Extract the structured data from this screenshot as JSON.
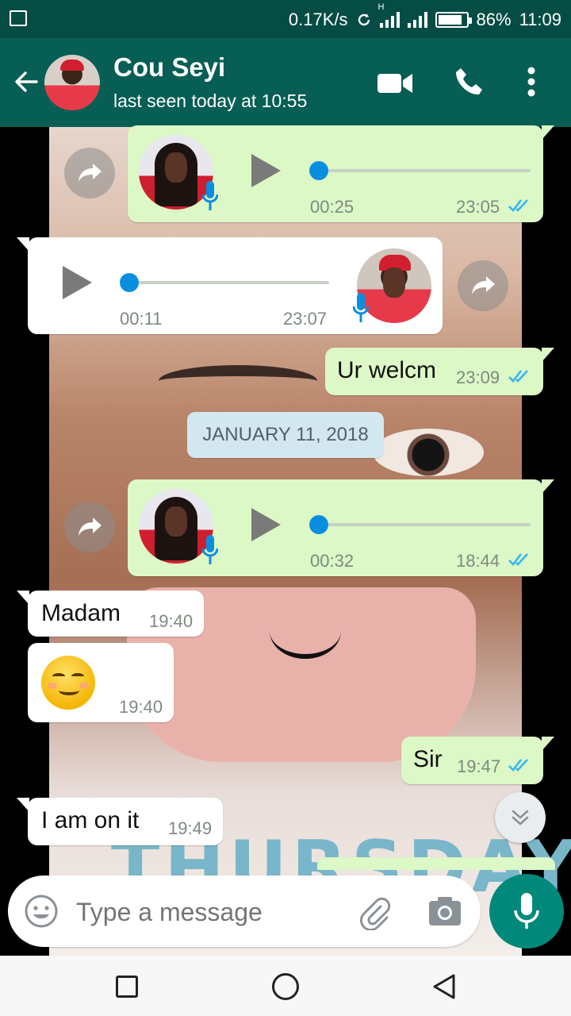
{
  "status_bar": {
    "speed": "0.17K/s",
    "network": "H",
    "battery": "86%",
    "clock": "11:09"
  },
  "chat_header": {
    "name": "Cou Seyi",
    "last_seen": "last seen today at 10:55"
  },
  "messages": [
    {
      "type": "voice",
      "direction": "out",
      "duration": "00:25",
      "time": "23:05",
      "read": true
    },
    {
      "type": "voice",
      "direction": "in",
      "duration": "00:11",
      "time": "23:07"
    },
    {
      "type": "text",
      "direction": "out",
      "text": "Ur welcm",
      "time": "23:09",
      "read": true
    },
    {
      "type": "date",
      "text": "JANUARY 11, 2018"
    },
    {
      "type": "voice",
      "direction": "out",
      "duration": "00:32",
      "time": "18:44",
      "read": true
    },
    {
      "type": "text",
      "direction": "in",
      "text": "Madam",
      "time": "19:40"
    },
    {
      "type": "emoji",
      "direction": "in",
      "emoji": "relieved-face",
      "time": "19:40"
    },
    {
      "type": "text",
      "direction": "out",
      "text": "Sir",
      "time": "19:47",
      "read": true
    },
    {
      "type": "text",
      "direction": "in",
      "text": "I am on it",
      "time": "19:49"
    }
  ],
  "composer": {
    "placeholder": "Type a message"
  },
  "colors": {
    "header": "#075e54",
    "status": "#054d44",
    "outgoing": "#dcf8c6",
    "incoming": "#ffffff",
    "read_ticks": "#34b7f1",
    "fab": "#00897b"
  },
  "wallpaper_text": "THURSDAY"
}
